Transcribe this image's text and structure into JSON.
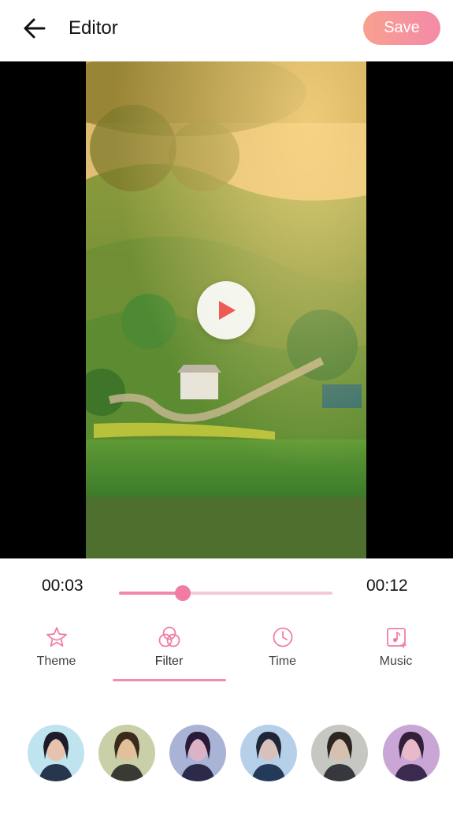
{
  "header": {
    "title": "Editor",
    "save_label": "Save",
    "back_icon": "arrow-left-icon"
  },
  "player": {
    "play_icon": "play-icon",
    "current_time": "00:03",
    "total_time": "00:12",
    "progress": 0.3
  },
  "tabs": [
    {
      "label": "Theme",
      "icon": "star-icon",
      "selected": false
    },
    {
      "label": "Filter",
      "icon": "filter-circles-icon",
      "selected": true
    },
    {
      "label": "Time",
      "icon": "clock-icon",
      "selected": false
    },
    {
      "label": "Music",
      "icon": "music-note-icon",
      "selected": false
    }
  ],
  "filters": {
    "count": 6
  },
  "colors": {
    "accent": "#f088ab",
    "save_gradient_start": "#f9a08f",
    "save_gradient_end": "#f48aa8",
    "play_triangle": "#ee5a56"
  }
}
